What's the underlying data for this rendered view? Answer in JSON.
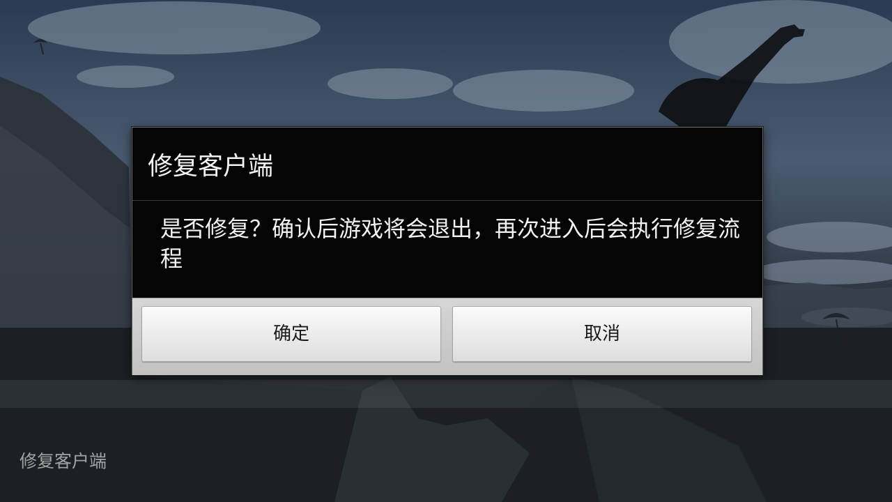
{
  "dialog": {
    "title": "修复客户端",
    "message": "是否修复？确认后游戏将会退出，再次进入后会执行修复流程",
    "confirm_label": "确定",
    "cancel_label": "取消"
  },
  "screen": {
    "bottom_label": "修复客户端"
  },
  "colors": {
    "dialog_background": "#050505",
    "dialog_text": "#f2f2f2",
    "button_face": "#ececec",
    "button_text": "#1a1a1a"
  },
  "icons": {
    "background_art": "skydiver-silhouette"
  }
}
